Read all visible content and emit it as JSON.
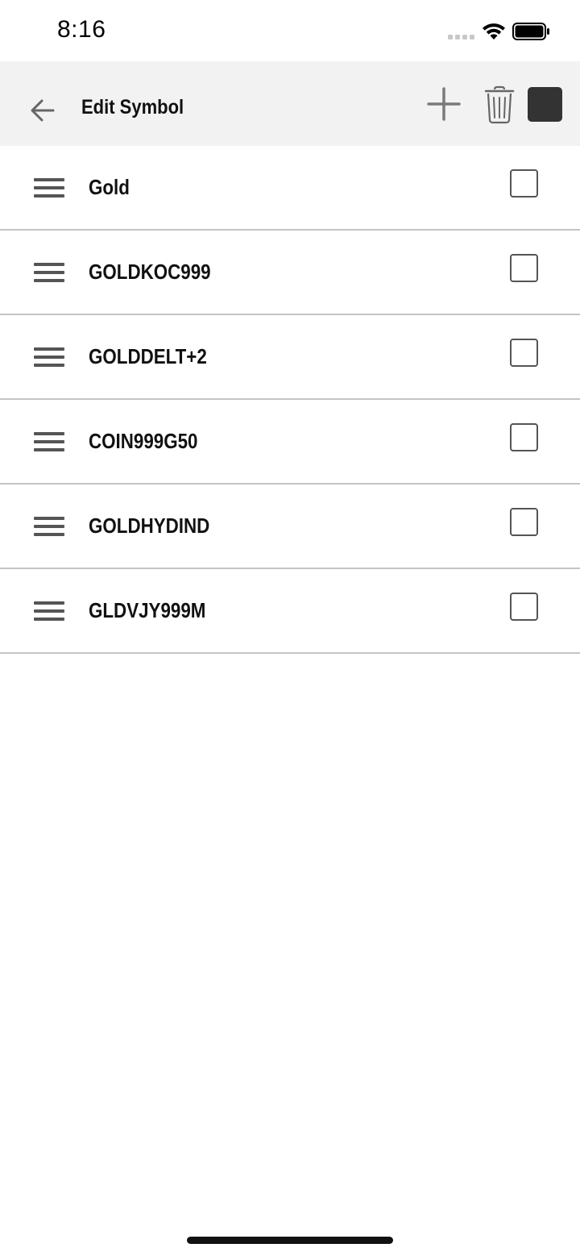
{
  "status_bar": {
    "time": "8:16"
  },
  "toolbar": {
    "title": "Edit Symbol",
    "icons": {
      "back": "arrow-left-icon",
      "add": "plus-icon",
      "delete": "trash-icon",
      "select_all": "filled-square-icon"
    }
  },
  "symbols": [
    {
      "label": "Gold",
      "checked": false
    },
    {
      "label": "GOLDKOC999",
      "checked": false
    },
    {
      "label": "GOLDDELT+2",
      "checked": false
    },
    {
      "label": "COIN999G50",
      "checked": false
    },
    {
      "label": "GOLDHYDIND",
      "checked": false
    },
    {
      "label": "GLDVJY999M",
      "checked": false
    }
  ],
  "colors": {
    "toolbar_bg": "#f2f2f2",
    "divider": "#c4c4c4",
    "icon_gray": "#777777",
    "select_all_fill": "#333333"
  }
}
